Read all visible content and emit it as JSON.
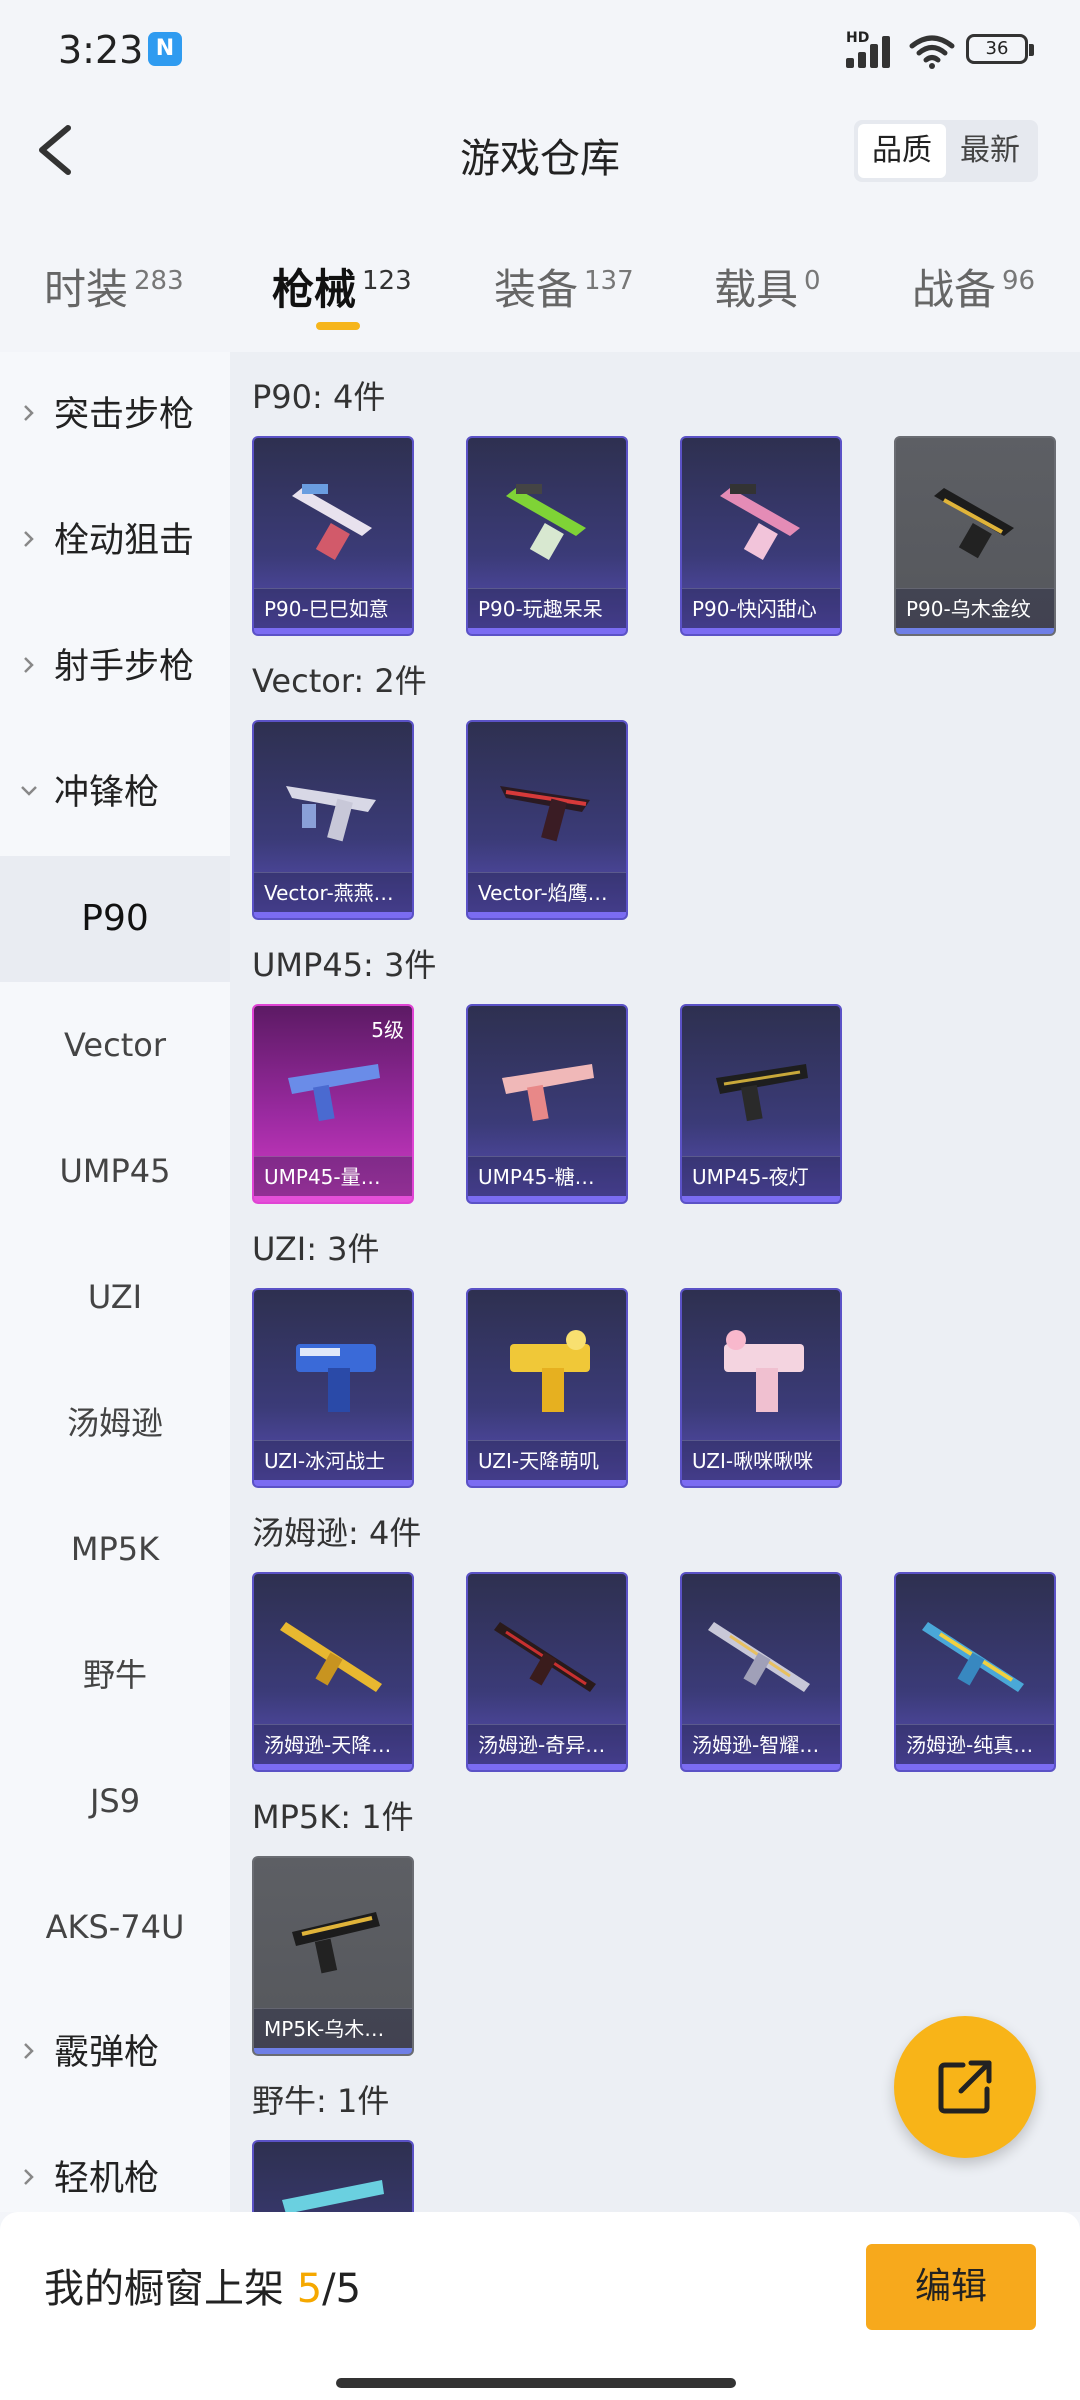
{
  "status": {
    "time": "3:23",
    "battery": "36",
    "hd": "HD"
  },
  "header": {
    "title": "游戏仓库",
    "sort": [
      "品质",
      "最新"
    ]
  },
  "tabs": [
    {
      "label": "时装",
      "count": "283"
    },
    {
      "label": "枪械",
      "count": "123"
    },
    {
      "label": "装备",
      "count": "137"
    },
    {
      "label": "载具",
      "count": "0"
    },
    {
      "label": "战备",
      "count": "96"
    }
  ],
  "sidebar": {
    "categories": [
      "突击步枪",
      "栓动狙击",
      "射手步枪",
      "冲锋枪",
      "霰弹枪",
      "轻机枪"
    ],
    "subitems": [
      "P90",
      "Vector",
      "UMP45",
      "UZI",
      "汤姆逊",
      "MP5K",
      "野牛",
      "JS9",
      "AKS-74U"
    ]
  },
  "sections": [
    {
      "label": "P90: 4件",
      "items": [
        "P90-巳巳如意",
        "P90-玩趣呆呆",
        "P90-快闪甜心",
        "P90-乌木金纹"
      ]
    },
    {
      "label": "Vector: 2件",
      "items": [
        "Vector-燕燕…",
        "Vector-焰鹰…"
      ]
    },
    {
      "label": "UMP45: 3件",
      "items": [
        "UMP45-量…",
        "UMP45-糖…",
        "UMP45-夜灯"
      ],
      "level": "5级"
    },
    {
      "label": "UZI: 3件",
      "items": [
        "UZI-冰河战士",
        "UZI-天降萌叽",
        "UZI-啾咪啾咪"
      ]
    },
    {
      "label": "汤姆逊: 4件",
      "items": [
        "汤姆逊-天降…",
        "汤姆逊-奇异…",
        "汤姆逊-智耀…",
        "汤姆逊-纯真…"
      ]
    },
    {
      "label": "MP5K: 1件",
      "items": [
        "MP5K-乌木…"
      ]
    },
    {
      "label": "野牛: 1件",
      "items": []
    }
  ],
  "colors": {
    "accent": "#f6b51b",
    "card_purple": "#5b52c6",
    "card_pink": "#d43bc6",
    "card_gray": "#55575c"
  },
  "bottom": {
    "showcase_prefix": "我的橱窗上架 ",
    "showcase_count": "5",
    "showcase_total": "/5",
    "edit": "编辑"
  }
}
